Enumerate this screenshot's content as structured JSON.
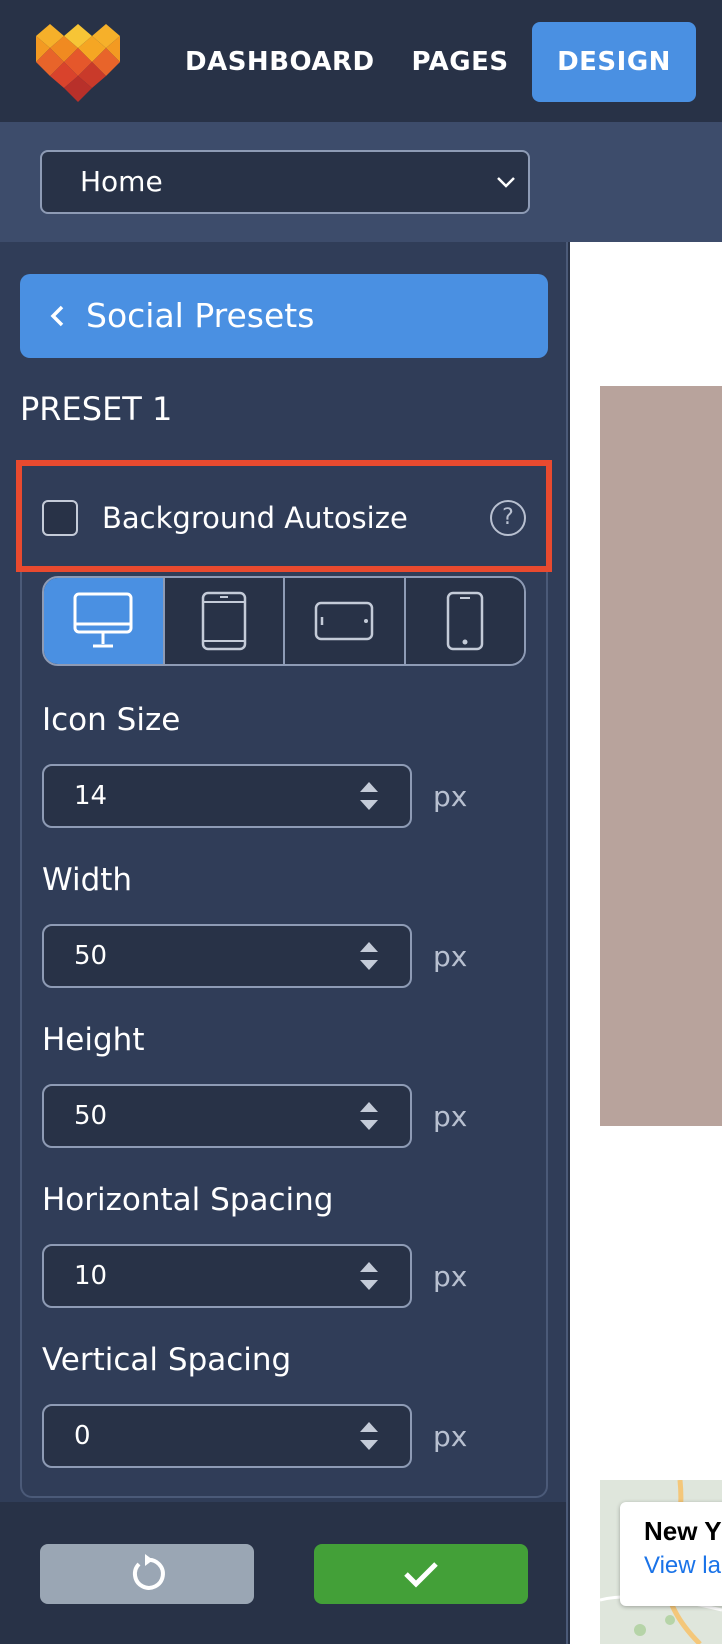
{
  "nav": {
    "items": [
      {
        "label": "DASHBOARD",
        "active": false
      },
      {
        "label": "PAGES",
        "active": false
      },
      {
        "label": "DESIGN",
        "active": true
      }
    ]
  },
  "page_selector": {
    "value": "Home"
  },
  "sidebar": {
    "back_label": "Social Presets",
    "preset_title": "PRESET 1",
    "autosize": {
      "label": "Background Autosize",
      "checked": false,
      "help": "?"
    },
    "devices": [
      {
        "name": "desktop",
        "active": true
      },
      {
        "name": "tablet-portrait",
        "active": false
      },
      {
        "name": "tablet-landscape",
        "active": false
      },
      {
        "name": "phone",
        "active": false
      }
    ],
    "fields": [
      {
        "label": "Icon Size",
        "value": "14",
        "unit": "px"
      },
      {
        "label": "Width",
        "value": "50",
        "unit": "px"
      },
      {
        "label": "Height",
        "value": "50",
        "unit": "px"
      },
      {
        "label": "Horizontal Spacing",
        "value": "10",
        "unit": "px"
      },
      {
        "label": "Vertical Spacing",
        "value": "0",
        "unit": "px"
      }
    ]
  },
  "preview": {
    "map_title": "New Y",
    "map_link": "View la"
  },
  "colors": {
    "accent": "#4a90e2",
    "highlight": "#e84a2f",
    "confirm": "#43a038",
    "reset": "#9aa6b4"
  }
}
